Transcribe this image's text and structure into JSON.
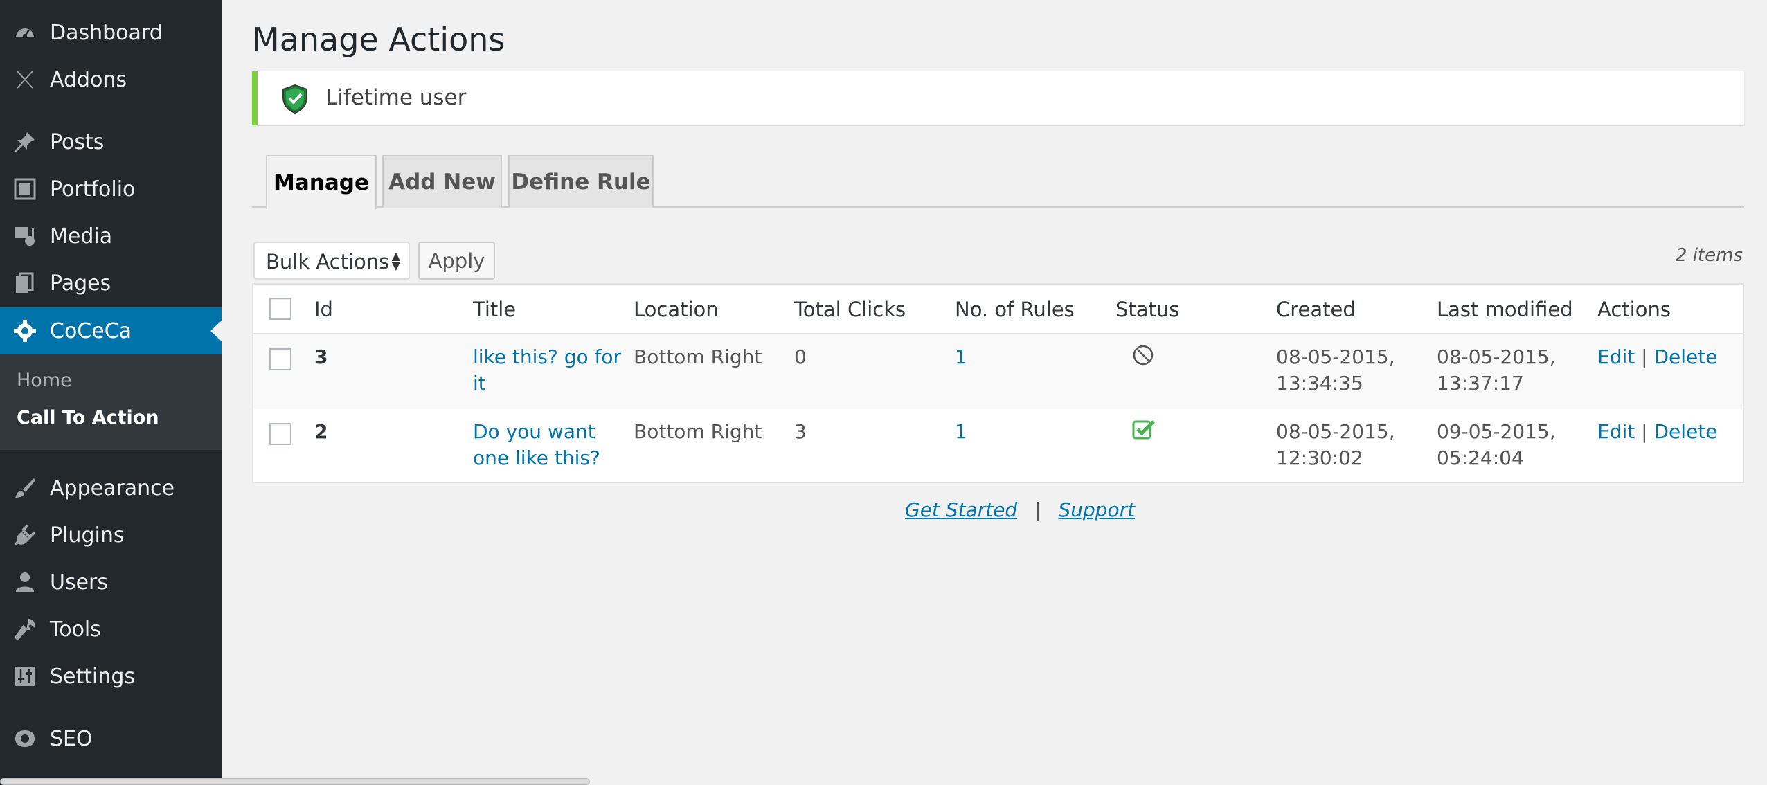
{
  "sidebar": {
    "items": [
      {
        "label": "Dashboard",
        "icon": "dashboard-icon"
      },
      {
        "label": "Addons",
        "icon": "addons-icon"
      },
      {
        "label": "Posts",
        "icon": "pin-icon"
      },
      {
        "label": "Portfolio",
        "icon": "portfolio-icon"
      },
      {
        "label": "Media",
        "icon": "media-icon"
      },
      {
        "label": "Pages",
        "icon": "pages-icon"
      },
      {
        "label": "CoCeCa",
        "icon": "gear-icon"
      },
      {
        "label": "Appearance",
        "icon": "paintbrush-icon"
      },
      {
        "label": "Plugins",
        "icon": "plugin-icon"
      },
      {
        "label": "Users",
        "icon": "user-icon"
      },
      {
        "label": "Tools",
        "icon": "wrench-icon"
      },
      {
        "label": "Settings",
        "icon": "settings-sliders-icon"
      },
      {
        "label": "SEO",
        "icon": "seo-icon"
      }
    ],
    "active_item": "CoCeCa",
    "submenu": [
      {
        "label": "Home"
      },
      {
        "label": "Call To Action"
      }
    ]
  },
  "header": {
    "title": "Manage Actions"
  },
  "notice": {
    "text": "Lifetime user",
    "icon": "shield-check-icon",
    "accent": "#7ad03a"
  },
  "tabs": [
    {
      "label": "Manage",
      "active": true
    },
    {
      "label": "Add New",
      "active": false
    },
    {
      "label": "Define Rule",
      "active": false
    }
  ],
  "toolbar": {
    "bulk_actions_value": "Bulk Actions",
    "apply_label": "Apply",
    "items_count": "2 items"
  },
  "table": {
    "columns": [
      "Id",
      "Title",
      "Location",
      "Total Clicks",
      "No. of Rules",
      "Status",
      "Created",
      "Last modified",
      "Actions"
    ],
    "rows": [
      {
        "id": "3",
        "title_line1": "like this? go for",
        "title_line2": "it",
        "location": "Bottom Right",
        "total_clicks": "0",
        "rules": "1",
        "status": "disabled",
        "status_icon": "disabled-circle-icon",
        "created_line1": "08-05-2015,",
        "created_line2": "13:34:35",
        "modified_line1": "08-05-2015,",
        "modified_line2": "13:37:17",
        "edit": "Edit",
        "sep": "|",
        "delete": "Delete"
      },
      {
        "id": "2",
        "title_line1": "Do you want",
        "title_line2": "one like this?",
        "location": "Bottom Right",
        "total_clicks": "3",
        "rules": "1",
        "status": "enabled",
        "status_icon": "check-box-icon",
        "created_line1": "08-05-2015,",
        "created_line2": "12:30:02",
        "modified_line1": "09-05-2015,",
        "modified_line2": "05:24:04",
        "edit": "Edit",
        "sep": "|",
        "delete": "Delete"
      }
    ]
  },
  "footer": {
    "get_started": "Get Started",
    "sep": "|",
    "support": "Support"
  },
  "colors": {
    "sidebar_bg": "#23282d",
    "active_blue": "#0073aa",
    "link": "#0073aa",
    "status_green": "#46b450"
  }
}
